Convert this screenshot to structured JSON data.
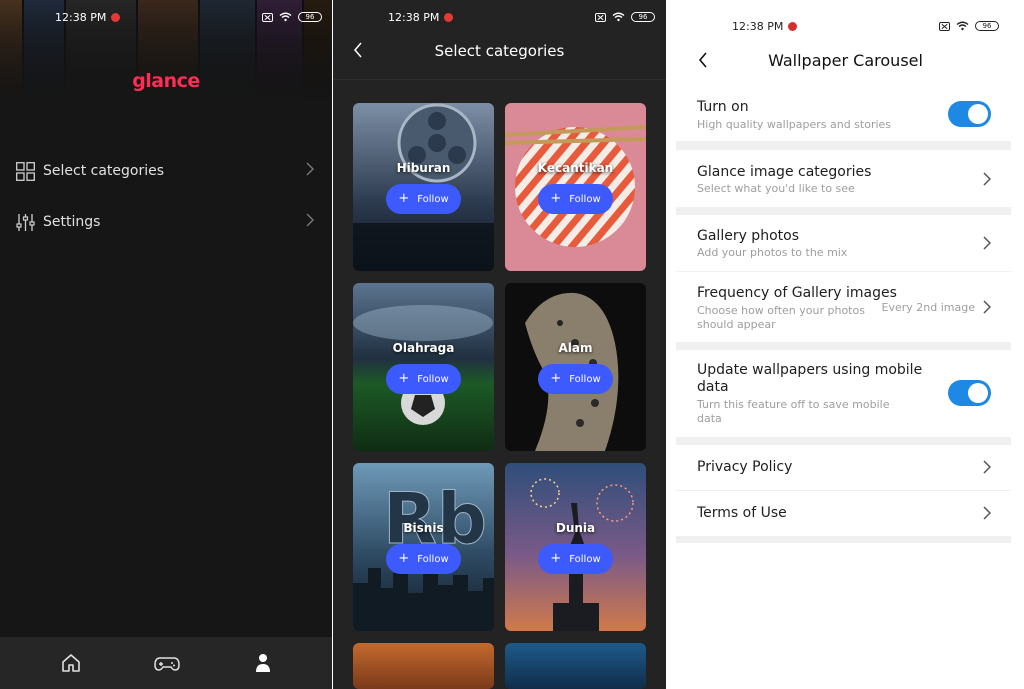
{
  "panel1": {
    "status_time": "12:38 PM",
    "battery": "96",
    "logo": "glance",
    "menu": [
      {
        "label": "Select categories",
        "icon": "grid-icon"
      },
      {
        "label": "Settings",
        "icon": "sliders-icon"
      }
    ],
    "bottom_nav": [
      "home-icon",
      "gamepad-icon",
      "person-icon"
    ]
  },
  "panel2": {
    "status_time": "12:38 PM",
    "battery": "96",
    "title": "Select categories",
    "categories": [
      {
        "name": "Hiburan",
        "follow": "Follow"
      },
      {
        "name": "Kecantikan",
        "follow": "Follow"
      },
      {
        "name": "Olahraga",
        "follow": "Follow"
      },
      {
        "name": "Alam",
        "follow": "Follow"
      },
      {
        "name": "Bisnis",
        "follow": "Follow"
      },
      {
        "name": "Dunia",
        "follow": "Follow"
      }
    ]
  },
  "panel3": {
    "status_time": "12:38 PM",
    "battery": "96",
    "title": "Wallpaper Carousel",
    "turn_on": {
      "title": "Turn on",
      "subtitle": "High quality wallpapers and stories",
      "enabled": true
    },
    "image_categories": {
      "title": "Glance image categories",
      "subtitle": "Select what you'd like to see"
    },
    "gallery": {
      "title": "Gallery photos",
      "subtitle": "Add your photos to the mix"
    },
    "frequency": {
      "title": "Frequency of Gallery images",
      "subtitle_line1": "Choose how often your photos",
      "subtitle_line2": "should appear",
      "value": "Every 2nd image"
    },
    "mobile_data": {
      "title_line1": "Update wallpapers using mobile",
      "title_line2": "data",
      "subtitle_line1": "Turn this feature off to save mobile",
      "subtitle_line2": "data",
      "enabled": true
    },
    "privacy": "Privacy Policy",
    "terms": "Terms of Use",
    "colors": {
      "accent": "#1e88e5",
      "follow": "#3d5afe",
      "logo": "#ff2d55"
    }
  }
}
